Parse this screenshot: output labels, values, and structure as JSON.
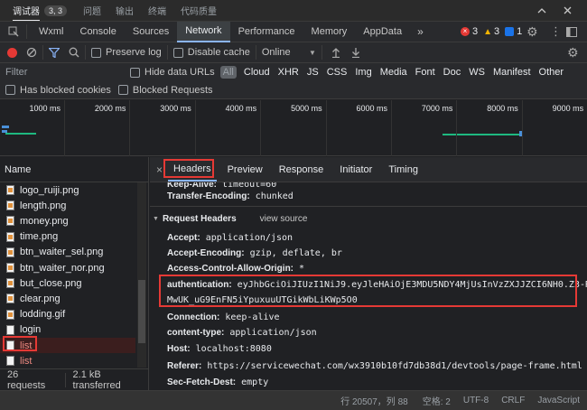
{
  "top_tabs": {
    "debugger_label": "调试器",
    "debugger_badge": "3, 3",
    "issues_label": "问题",
    "output_label": "输出",
    "terminal_label": "终端",
    "quality_label": "代码质量"
  },
  "devtools_tabs": {
    "items": [
      "Wxml",
      "Console",
      "Sources",
      "Network",
      "Performance",
      "Memory",
      "AppData"
    ],
    "active": "Network",
    "more": "»",
    "errors": "3",
    "warnings": "3",
    "info": "1"
  },
  "toolbar": {
    "preserve_log": "Preserve log",
    "disable_cache": "Disable cache",
    "throttling": "Online"
  },
  "filter": {
    "placeholder": "Filter",
    "hide_data_urls": "Hide data URLs",
    "types": [
      "All",
      "Cloud",
      "XHR",
      "JS",
      "CSS",
      "Img",
      "Media",
      "Font",
      "Doc",
      "WS",
      "Manifest",
      "Other"
    ],
    "has_blocked_cookies": "Has blocked cookies",
    "blocked_requests": "Blocked Requests"
  },
  "timeline": {
    "ticks": [
      "1000 ms",
      "2000 ms",
      "3000 ms",
      "4000 ms",
      "5000 ms",
      "6000 ms",
      "7000 ms",
      "8000 ms",
      "9000 ms"
    ]
  },
  "request_list": {
    "header": "Name",
    "items": [
      {
        "name": "logo_ruiji.png",
        "icon": "image-icon",
        "failed": false
      },
      {
        "name": "length.png",
        "icon": "image-icon",
        "failed": false
      },
      {
        "name": "money.png",
        "icon": "image-icon",
        "failed": false
      },
      {
        "name": "time.png",
        "icon": "image-icon",
        "failed": false
      },
      {
        "name": "btn_waiter_sel.png",
        "icon": "image-icon",
        "failed": false
      },
      {
        "name": "btn_waiter_nor.png",
        "icon": "image-icon",
        "failed": false
      },
      {
        "name": "but_close.png",
        "icon": "image-icon",
        "failed": false
      },
      {
        "name": "clear.png",
        "icon": "image-icon",
        "failed": false
      },
      {
        "name": "lodding.gif",
        "icon": "image-icon",
        "failed": false
      },
      {
        "name": "login",
        "icon": "document-icon",
        "failed": false
      },
      {
        "name": "list",
        "icon": "document-icon",
        "failed": true
      },
      {
        "name": "list",
        "icon": "document-icon",
        "failed": true
      }
    ],
    "requests_count": "26 requests",
    "transferred": "2.1 kB transferred"
  },
  "detail_tabs": {
    "close": "×",
    "items": [
      "Headers",
      "Preview",
      "Response",
      "Initiator",
      "Timing"
    ],
    "active": "Headers"
  },
  "headers": {
    "keep_alive_key": "Keep-Alive:",
    "keep_alive_value": "timeout=60",
    "transfer_encoding_key": "Transfer-Encoding:",
    "transfer_encoding_value": "chunked",
    "request_headers_title": "Request Headers",
    "view_source": "view source",
    "accept_key": "Accept:",
    "accept_value": "application/json",
    "accept_encoding_key": "Accept-Encoding:",
    "accept_encoding_value": "gzip, deflate, br",
    "acao_key": "Access-Control-Allow-Origin:",
    "acao_value": "*",
    "auth_key": "authentication:",
    "auth_value_line1": "eyJhbGciOiJIUzI1NiJ9.eyJleHAiOjE3MDU5NDY4MjUsInVzZXJJZCI6NH0.Z3-RgIk5",
    "auth_value_line2": "MwUK_uG9EnFN5iYpuxuuUTGikWbLiKWp5O0",
    "connection_key": "Connection:",
    "connection_value": "keep-alive",
    "content_type_key": "content-type:",
    "content_type_value": "application/json",
    "host_key": "Host:",
    "host_value": "localhost:8080",
    "referer_key": "Referer:",
    "referer_value": "https://servicewechat.com/wx3910b10fd7db38d1/devtools/page-frame.html",
    "sec_fetch_key": "Sec-Fetch-Dest:",
    "sec_fetch_value": "empty"
  },
  "status_bar": {
    "position": "行 20507，列 88",
    "spaces": "空格: 2",
    "encoding": "UTF-8",
    "eol": "CRLF",
    "language": "JavaScript"
  },
  "colors": {
    "accent": "#1a73e8",
    "error": "#e53935",
    "highlight_box": "#e53935",
    "failed_text": "#f28b82"
  }
}
